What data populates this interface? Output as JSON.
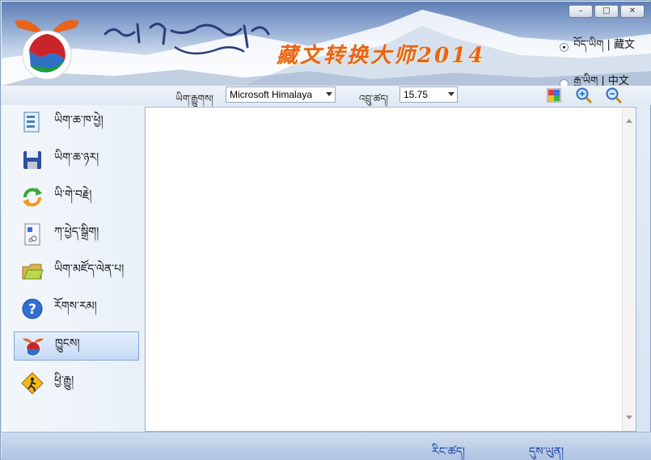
{
  "header": {
    "app_title_cn": "藏文转换大师2014",
    "window_buttons": [
      "–",
      "□",
      "✕"
    ],
    "languages": [
      {
        "label": "བོད་ཡིག | 藏文",
        "selected": true
      },
      {
        "label": "རྒྱ་ཡིག | 中文",
        "selected": false
      }
    ]
  },
  "toolbar": {
    "font_label": "ཡིག་རྒྱུགས།",
    "font_value": "Microsoft Himalaya",
    "size_label": "འབྲུ་ཚད།",
    "size_value": "15.75",
    "icons": [
      "color-grid-icon",
      "zoom-in-icon",
      "zoom-out-icon"
    ]
  },
  "sidebar": {
    "items": [
      {
        "label": "ཡིག་ཆ་ཁ་ཕྱེ།",
        "icon": "open-document-icon"
      },
      {
        "label": "ཡིག་ཆ་ཉར།",
        "icon": "save-disk-icon"
      },
      {
        "label": "ཡི་གེ་བརྗེ།",
        "icon": "convert-arrows-icon"
      },
      {
        "label": "ཀ་ཕྱེད་སྒྲིག།",
        "icon": "sort-document-icon"
      },
      {
        "label": "ཡིག་མཛོད་ལེན་པ།",
        "icon": "folder-icon"
      },
      {
        "label": "རོགས་རམ།",
        "icon": "help-icon"
      },
      {
        "label": "ཁྱུངས།",
        "icon": "logo-icon",
        "active": true
      },
      {
        "label": "ཕྱི་རྒྱུ།",
        "icon": "exit-icon"
      }
    ]
  },
  "statusbar": {
    "link1": "རིང་ཚད།",
    "link2": "དུས་ཡུན།"
  },
  "colors": {
    "accent": "#e8641a",
    "link": "#1a3fa8"
  }
}
